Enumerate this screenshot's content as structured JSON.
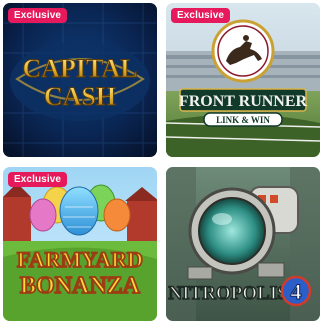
{
  "colors": {
    "badge": "#e5195c",
    "badge_text": "#ffffff"
  },
  "games": [
    {
      "title_line1": "CAPITAL",
      "title_line2": "CASH",
      "badge": "Exclusive",
      "icon": "gold-coin-logo"
    },
    {
      "title_line1": "FRONT",
      "title_line2": "RUNNER",
      "subtitle": "LINK & WIN",
      "badge": "Exclusive",
      "icon": "horse-racing-logo"
    },
    {
      "title_line1": "FARMYARD",
      "title_line2": "BONANZA",
      "badge": "Exclusive",
      "icon": "easter-eggs-basket"
    },
    {
      "title_line1": "NITROPOLIS",
      "title_line2": "4",
      "icon": "mech-robot"
    }
  ]
}
